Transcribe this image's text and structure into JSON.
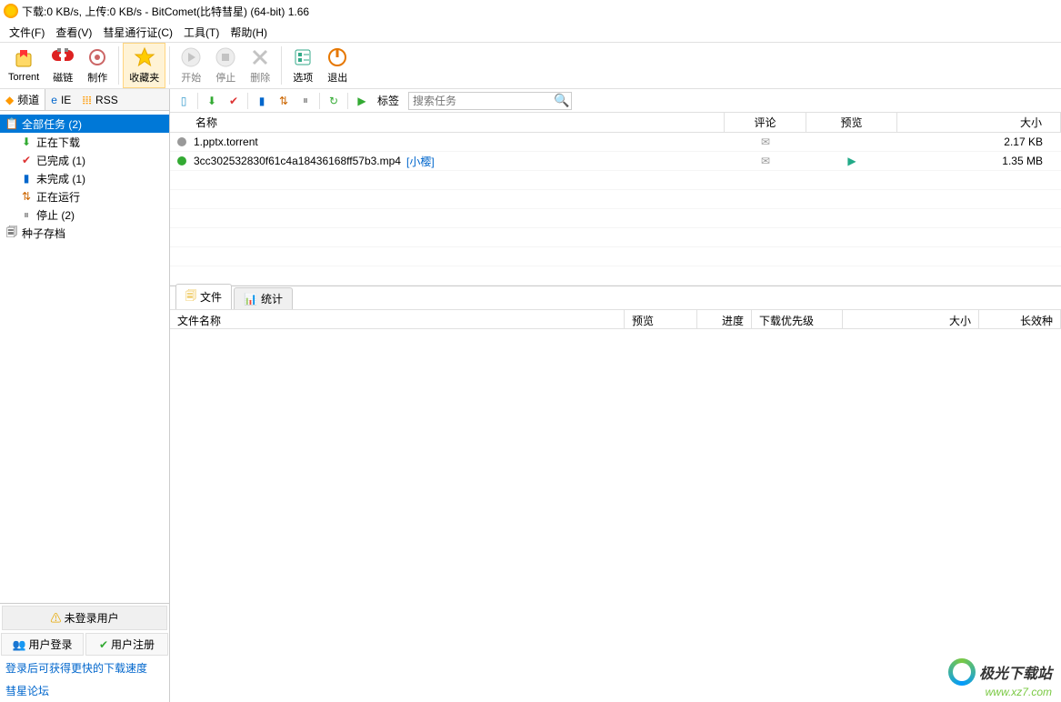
{
  "title": "下载:0 KB/s, 上传:0 KB/s - BitComet(比特彗星) (64-bit) 1.66",
  "menu": {
    "file": "文件(F)",
    "view": "查看(V)",
    "passport": "彗星通行证(C)",
    "tools": "工具(T)",
    "help": "帮助(H)"
  },
  "toolbar": {
    "torrent": "Torrent",
    "magnet": "磁链",
    "make": "制作",
    "favorites": "收藏夹",
    "start": "开始",
    "stop": "停止",
    "delete": "删除",
    "options": "选项",
    "exit": "退出"
  },
  "sidebar_tabs": {
    "channel": "频道",
    "ie": "IE",
    "rss": "RSS"
  },
  "tree": {
    "all_tasks": "全部任务 (2)",
    "downloading": "正在下载",
    "completed": "已完成 (1)",
    "incomplete": "未完成 (1)",
    "running": "正在运行",
    "stopped": "停止 (2)",
    "archive": "种子存档"
  },
  "login": {
    "header": "未登录用户",
    "login_btn": "用户登录",
    "register_btn": "用户注册",
    "note": "登录后可获得更快的下载速度",
    "forum": "彗星论坛"
  },
  "smallbar": {
    "tags_label": "标签",
    "search_placeholder": "搜索任务"
  },
  "list_header": {
    "name": "名称",
    "comment": "评论",
    "preview": "预览",
    "size": "大小"
  },
  "tasks": [
    {
      "status": "gray",
      "name": "1.pptx.torrent",
      "link": "",
      "comment": "mail",
      "preview": "",
      "size": "2.17 KB"
    },
    {
      "status": "green",
      "name": "3cc302532830f61c4a18436168ff57b3.mp4",
      "link": "[小樱]",
      "comment": "mail",
      "preview": "play",
      "size": "1.35 MB"
    }
  ],
  "detail_tabs": {
    "files": "文件",
    "stats": "统计"
  },
  "detail_header": {
    "name": "文件名称",
    "preview": "预览",
    "progress": "进度",
    "priority": "下载优先级",
    "size": "大小",
    "ext": "长效种"
  },
  "watermark": {
    "text": "极光下载站",
    "url": "www.xz7.com"
  }
}
